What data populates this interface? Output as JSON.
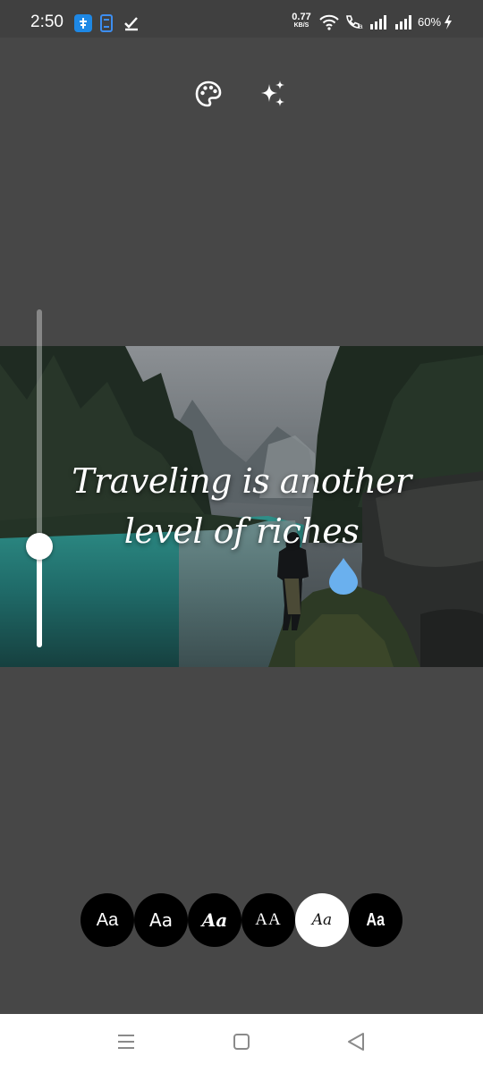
{
  "status_bar": {
    "time": "2:50",
    "net_speed_value": "0.77",
    "net_speed_unit": "KB/S",
    "battery": "60%",
    "icons": [
      "app-notification-icon",
      "screen-rotate-icon",
      "check-icon",
      "wifi-icon",
      "volte-call-icon",
      "signal-icon",
      "signal-icon",
      "charging-bolt-icon"
    ]
  },
  "toolbar": {
    "tools": [
      "palette-icon",
      "sparkles-icon"
    ]
  },
  "canvas": {
    "quote_line1": "Traveling is another",
    "quote_line2": "level of riches",
    "text_size_level": 0.3,
    "colors": {
      "accent_drop": "#6AB0EE",
      "background": "#474747"
    }
  },
  "font_picker": {
    "options": [
      "Aa",
      "Aa",
      "Aa",
      "AA",
      "Aa",
      "Aa"
    ],
    "selected_index": 4
  },
  "nav_bar": {
    "icons": [
      "menu-icon",
      "home-icon",
      "back-icon"
    ]
  }
}
